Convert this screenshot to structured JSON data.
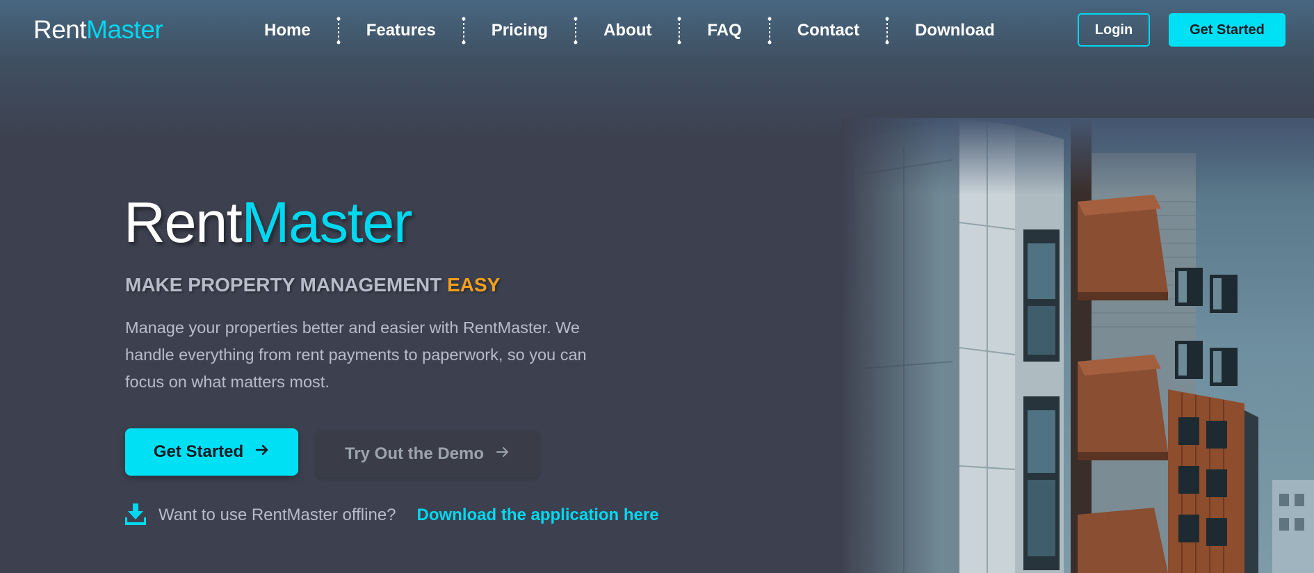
{
  "brand": {
    "name_part1": "Rent",
    "name_part2": "Master"
  },
  "nav": {
    "links": [
      "Home",
      "Features",
      "Pricing",
      "About",
      "FAQ",
      "Contact",
      "Download"
    ],
    "login_label": "Login",
    "get_started_label": "Get Started"
  },
  "hero": {
    "title_part1": "Rent",
    "title_part2": "Master",
    "subtitle_main": "MAKE PROPERTY MANAGEMENT ",
    "subtitle_highlight": "EASY",
    "description": "Manage your properties better and easier with RentMaster. We handle everything from rent payments to paperwork, so you can focus on what matters most.",
    "primary_button_label": "Get Started",
    "secondary_button_label": "Try Out the Demo",
    "offline_text": "Want to use RentMaster offline?",
    "download_link_label": "Download the application here"
  },
  "icons": {
    "arrow": "arrow-right-icon",
    "download": "download-icon",
    "separator": "dotted-separator-icon"
  },
  "colors": {
    "accent": "#00d8f0",
    "highlight": "#f4a01c",
    "background": "#3d414f",
    "text_muted": "#b6bcc9"
  }
}
